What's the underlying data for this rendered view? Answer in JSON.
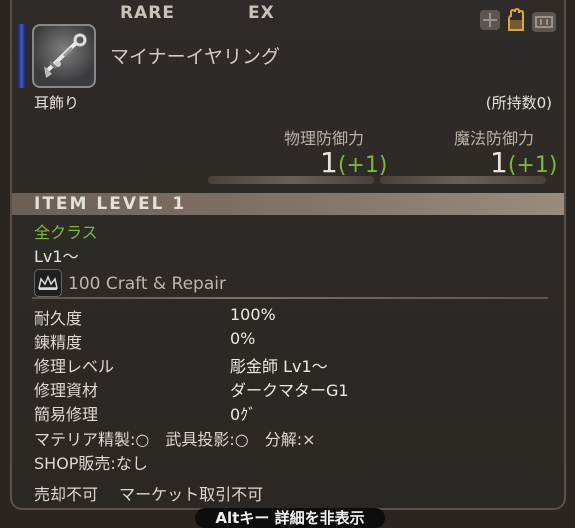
{
  "header": {
    "rarity_left": "RARE",
    "rarity_right": "EX",
    "item_name": "マイナーイヤリング",
    "category": "耳飾り",
    "owned": "(所持数0)"
  },
  "stats": {
    "phys_label": "物理防御力",
    "phys_value": "1",
    "phys_bonus": "(+1)",
    "mag_label": "魔法防御力",
    "mag_value": "1",
    "mag_bonus": "(+1)"
  },
  "item_level": "ITEM LEVEL  1",
  "classes": "全クラス",
  "level_req": "Lv1〜",
  "craft_repair": "100 Craft & Repair",
  "details": [
    {
      "label": "耐久度",
      "value": "100%"
    },
    {
      "label": "錬精度",
      "value": "0%"
    },
    {
      "label": "修理レベル",
      "value": "彫金師 Lv1〜"
    },
    {
      "label": "修理資材",
      "value": "ダークマターG1"
    },
    {
      "label": "簡易修理",
      "value": "0ｸﾞ"
    }
  ],
  "materia_line": "マテリア精製:○　武具投影:○　分解:×",
  "shop_line": "SHOP販売:なし",
  "market_line": "売却不可　 マーケット取引不可",
  "footer_hint": "Altキー 詳細を非表示",
  "icons": {
    "item": "earring-icon",
    "craft": "crown-icon"
  },
  "colors": {
    "green": "#7dbb2e",
    "rarity_bar": "#3a58c8"
  }
}
